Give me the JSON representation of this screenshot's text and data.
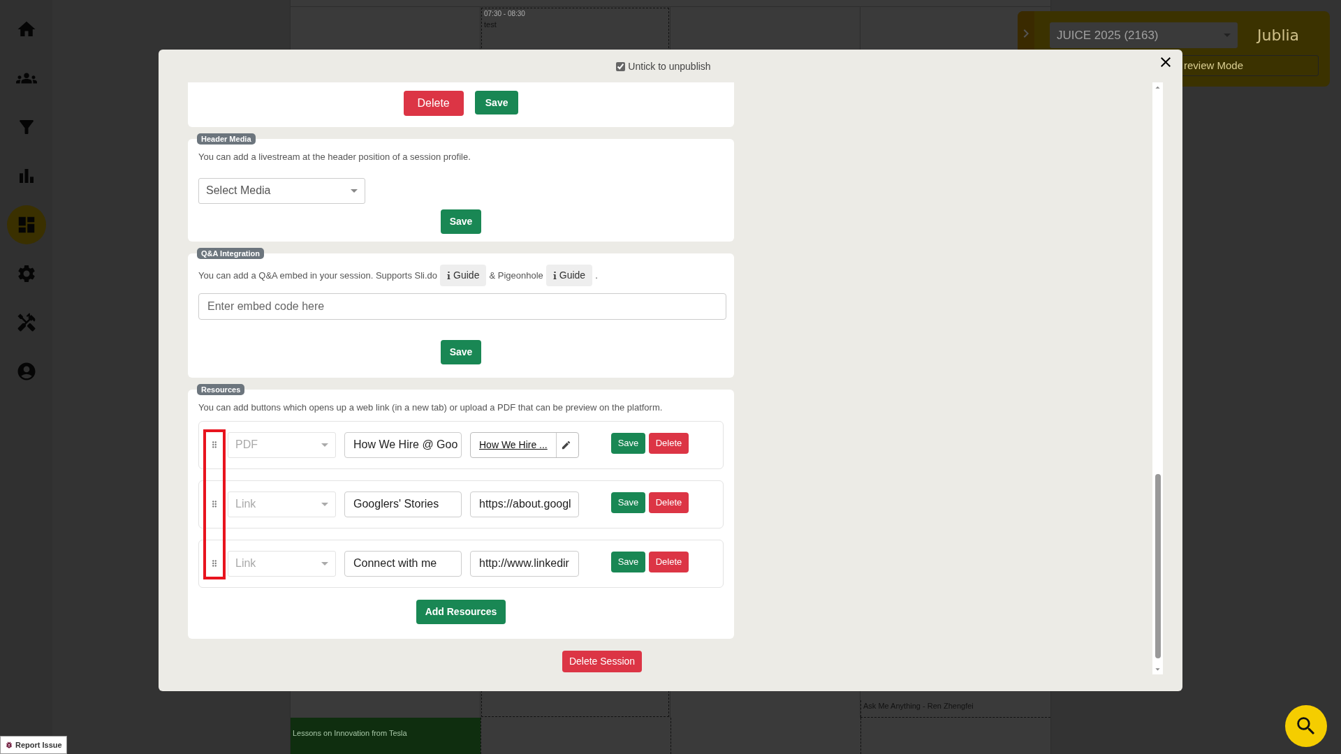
{
  "sidebar": {
    "items": [
      {
        "kind": "home",
        "selected": false
      },
      {
        "kind": "people",
        "selected": false
      },
      {
        "kind": "filter",
        "selected": false
      },
      {
        "kind": "chart",
        "selected": false
      },
      {
        "kind": "dashboard",
        "selected": true
      },
      {
        "kind": "settings",
        "selected": false
      },
      {
        "kind": "tools",
        "selected": false
      },
      {
        "kind": "account",
        "selected": false
      }
    ]
  },
  "calendar": {
    "events": [
      {
        "time": "07:30 - 08:30",
        "title": "test"
      },
      {
        "title": "Ask Me Anything - Ren Zhengfei"
      },
      {
        "title": "Lessons on Innovation from Tesla"
      }
    ]
  },
  "event_panel": {
    "event_select": "JUICE 2025 (2163)",
    "logo": "Jublia",
    "mode_button": "review Mode"
  },
  "report_issue": "Report Issue",
  "modal": {
    "publish": {
      "label": "Untick to unpublish",
      "checked": true
    },
    "top_actions": {
      "delete": "Delete",
      "save": "Save"
    },
    "header_media": {
      "badge": "Header Media",
      "description": "You can add a livestream at the header position of a session profile.",
      "select_placeholder": "Select Media",
      "save": "Save"
    },
    "qa": {
      "badge": "Q&A Integration",
      "text_1": "You can add a Q&A embed in your session. Supports Sli.do",
      "guide_1": "Guide",
      "text_2": "& Pigeonhole",
      "guide_2": "Guide",
      "text_3": ".",
      "placeholder": "Enter embed code here",
      "save": "Save"
    },
    "resources": {
      "badge": "Resources",
      "description": "You can add buttons which opens up a web link (in a new tab) or upload a PDF that can be preview on the platform.",
      "rows": [
        {
          "kind": "pdf",
          "type": "PDF",
          "name": "How We Hire @ Goo",
          "file": "How We Hire ...",
          "save": "Save",
          "delete": "Delete"
        },
        {
          "kind": "link",
          "type": "Link",
          "name": "Googlers' Stories",
          "url": "https://about.googl",
          "save": "Save",
          "delete": "Delete"
        },
        {
          "kind": "link",
          "type": "Link",
          "name": "Connect with me",
          "url": "http://www.linkedir",
          "save": "Save",
          "delete": "Delete"
        }
      ],
      "add": "Add Resources"
    },
    "delete_session": "Delete Session"
  }
}
